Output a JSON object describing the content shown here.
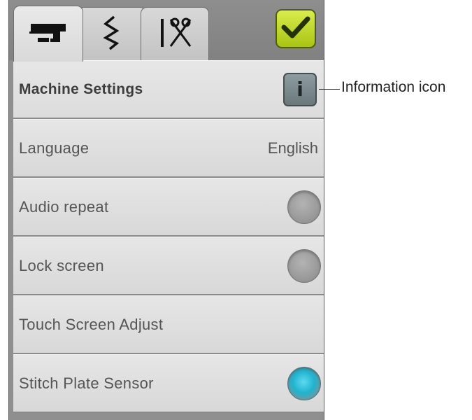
{
  "tabs": [
    {
      "icon": "sewing-machine-icon",
      "active": true
    },
    {
      "icon": "zigzag-stitch-icon",
      "active": false
    },
    {
      "icon": "needle-scissors-icon",
      "active": false
    }
  ],
  "confirm_button": {
    "icon": "checkmark-icon",
    "color": "#b8d126"
  },
  "header": {
    "title": "Machine Settings",
    "info_button_label": "i"
  },
  "settings": [
    {
      "label": "Language",
      "value": "English"
    },
    {
      "label": "Audio repeat",
      "toggle": "off"
    },
    {
      "label": "Lock screen",
      "toggle": "off"
    },
    {
      "label": "Touch Screen Adjust"
    },
    {
      "label": "Stitch Plate Sensor",
      "toggle": "on"
    }
  ],
  "callout": {
    "text": "Information icon"
  },
  "colors": {
    "toggle_on": "#1fb3cf",
    "toggle_off": "#9a9a9a",
    "ok_green": "#b8d126"
  }
}
